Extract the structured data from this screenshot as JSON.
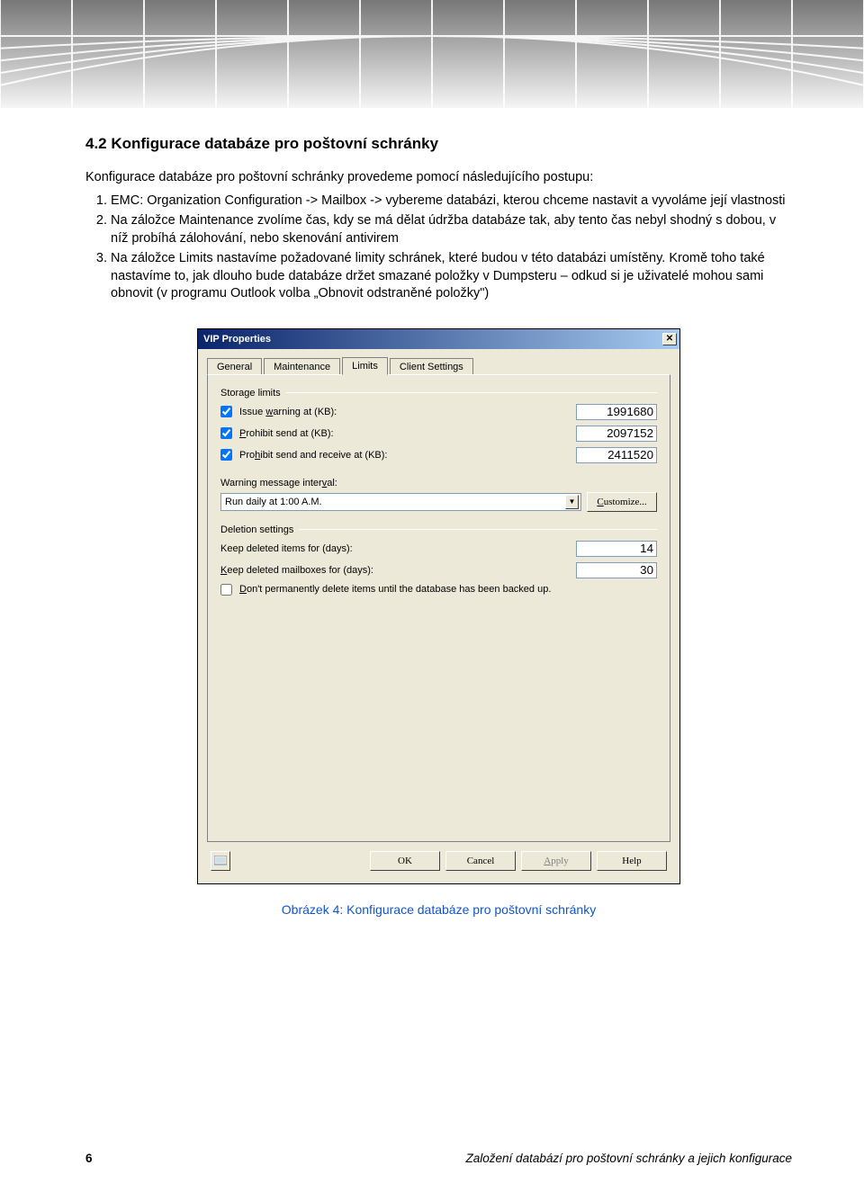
{
  "heading": "4.2   Konfigurace databáze pro poštovní schránky",
  "intro": "Konfigurace databáze pro poštovní schránky provedeme pomocí následujícího postupu:",
  "steps": [
    "EMC: Organization Configuration -> Mailbox -> vybereme databázi, kterou chceme nastavit a vyvoláme její vlastnosti",
    "Na záložce Maintenance zvolíme čas, kdy se má dělat údržba databáze tak, aby tento čas nebyl shodný s dobou, v níž probíhá zálohování, nebo skenování antivirem",
    "Na záložce Limits nastavíme požadované limity schránek, které budou v této databázi umístěny. Kromě toho také nastavíme to, jak dlouho bude databáze držet smazané položky v Dumpsteru – odkud si je uživatelé mohou sami obnovit (v programu Outlook volba „Obnovit odstraněné položky\")"
  ],
  "dialog": {
    "title": "VIP Properties",
    "tabs": [
      "General",
      "Maintenance",
      "Limits",
      "Client Settings"
    ],
    "active_tab": "Limits",
    "storage_limits_label": "Storage limits",
    "issue_warning_label": "Issue warning at (KB):",
    "issue_warning_value": "1991680",
    "prohibit_send_label": "Prohibit send at (KB):",
    "prohibit_send_value": "2097152",
    "prohibit_sr_label": "Prohibit send and receive at (KB):",
    "prohibit_sr_value": "2411520",
    "warning_interval_label": "Warning message interval:",
    "warning_interval_value": "Run daily at 1:00 A.M.",
    "customize_label": "Customize...",
    "deletion_label": "Deletion settings",
    "keep_items_label": "Keep deleted items for (days):",
    "keep_items_value": "14",
    "keep_mailboxes_label": "Keep deleted mailboxes for (days):",
    "keep_mailboxes_value": "30",
    "dont_delete_label": "Don't permanently delete items until the database has been backed up.",
    "ok": "OK",
    "cancel": "Cancel",
    "apply": "Apply",
    "help": "Help"
  },
  "caption": "Obrázek 4: Konfigurace databáze pro poštovní schránky",
  "footer_page": "6",
  "footer_text": "Založení databází pro poštovní schránky a jejich konfigurace"
}
